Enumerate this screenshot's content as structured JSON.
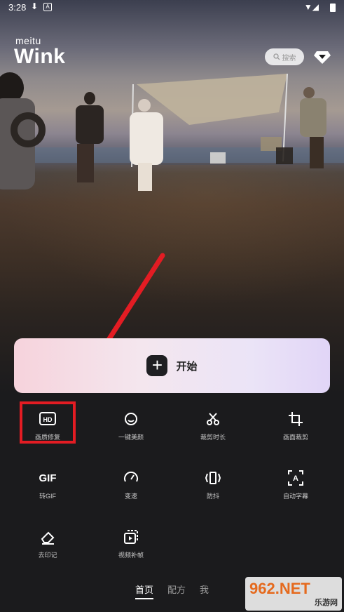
{
  "status_bar": {
    "time": "3:28"
  },
  "app": {
    "brand": "meitu",
    "name": "Wink"
  },
  "search": {
    "placeholder": "搜索"
  },
  "start_button": {
    "label": "开始",
    "plus": "+"
  },
  "tools_row1": [
    {
      "icon": "hd-icon",
      "label": "画质修复"
    },
    {
      "icon": "face-icon",
      "label": "一键美颜"
    },
    {
      "icon": "scissors-icon",
      "label": "裁剪时长"
    },
    {
      "icon": "crop-icon",
      "label": "画面裁剪"
    }
  ],
  "tools_row2": [
    {
      "icon": "gif-icon",
      "label": "转GIF",
      "glyph": "GIF"
    },
    {
      "icon": "speed-icon",
      "label": "变速"
    },
    {
      "icon": "stabilize-icon",
      "label": "防抖"
    },
    {
      "icon": "subtitle-icon",
      "label": "自动字幕"
    }
  ],
  "tools_row3": [
    {
      "icon": "eraser-icon",
      "label": "去印记"
    },
    {
      "icon": "frame-fill-icon",
      "label": "视频补帧"
    }
  ],
  "nav": {
    "home": "首页",
    "recipe": "配方",
    "me": "我"
  },
  "watermark": {
    "main": "962.NET",
    "sub": "乐游网"
  },
  "colors": {
    "highlight": "#e31c23",
    "arrow": "#e31c23",
    "bg": "#1b1b1d"
  }
}
